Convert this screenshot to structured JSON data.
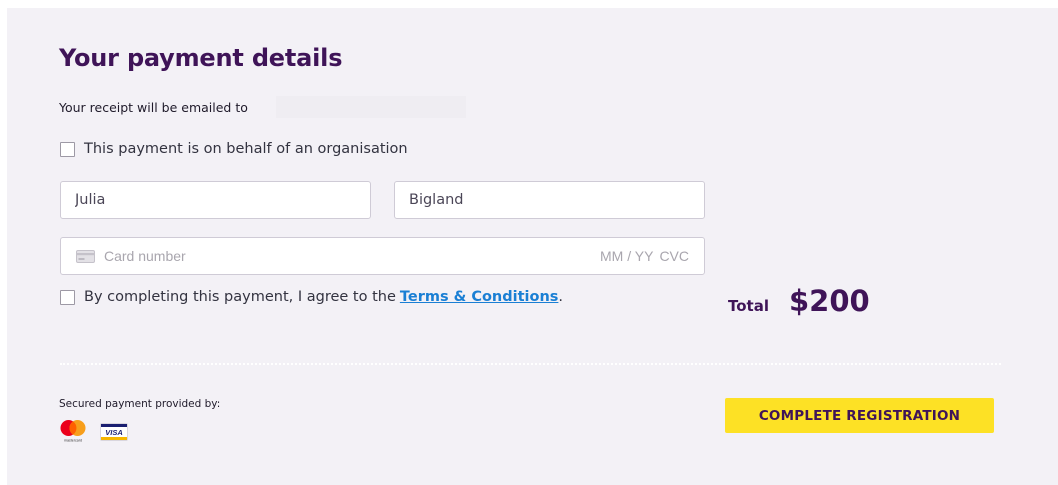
{
  "form": {
    "title": "Your payment details",
    "receipt_text": "Your receipt will be emailed to",
    "org_checkbox_label": "This payment is on behalf of an organisation",
    "first_name_value": "Julia",
    "last_name_value": "Bigland",
    "card": {
      "icon": "card-icon",
      "number_placeholder": "Card number",
      "expiry_placeholder": "MM / YY",
      "cvc_placeholder": "CVC"
    },
    "terms": {
      "prefix": "By completing this payment, I agree to the",
      "link_text": "Terms & Conditions",
      "suffix": "."
    }
  },
  "summary": {
    "total_label": "Total",
    "total_amount": "$200"
  },
  "footer": {
    "secured_text": "Secured payment provided by:",
    "logos": [
      "mastercard-logo",
      "visa-logo"
    ],
    "mastercard_wordmark": "mastercard",
    "visa_wordmark": "VISA",
    "cta_label": "COMPLETE REGISTRATION"
  },
  "colors": {
    "brand_purple": "#3f1458",
    "cta_yellow": "#fde125",
    "link_blue": "#1a7fd4",
    "panel_bg": "#f3f1f6"
  }
}
